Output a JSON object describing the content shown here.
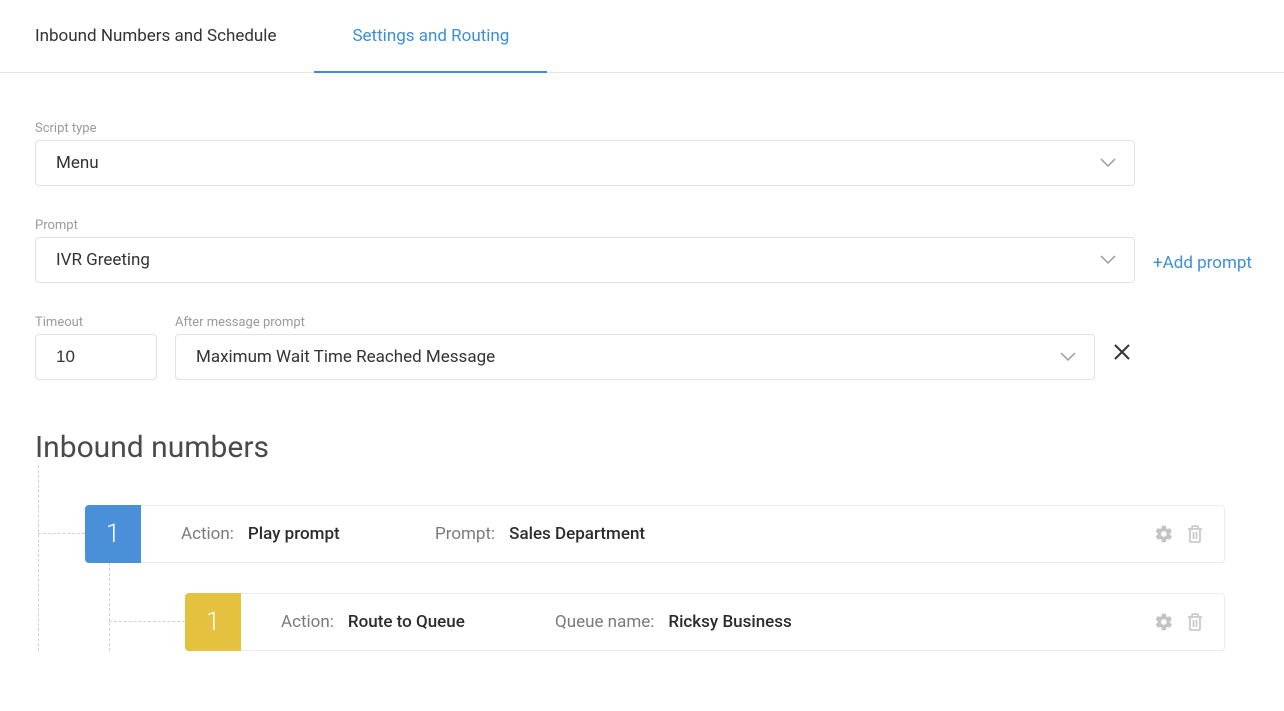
{
  "tabs": {
    "inbound": "Inbound Numbers and Schedule",
    "settings": "Settings and Routing"
  },
  "fields": {
    "script_type": {
      "label": "Script type",
      "value": "Menu"
    },
    "prompt": {
      "label": "Prompt",
      "value": "IVR Greeting"
    },
    "add_prompt": "+Add prompt",
    "timeout": {
      "label": "Timeout",
      "value": "10"
    },
    "after_msg": {
      "label": "After message prompt",
      "value": "Maximum Wait Time Reached Message"
    }
  },
  "section_title": "Inbound numbers",
  "nodes": {
    "n1": {
      "badge": "1",
      "action_label": "Action:",
      "action_value": "Play prompt",
      "param_label": "Prompt:",
      "param_value": "Sales Department"
    },
    "n1_1": {
      "badge": "1",
      "action_label": "Action:",
      "action_value": "Route to Queue",
      "param_label": "Queue name:",
      "param_value": "Ricksy Business"
    }
  }
}
